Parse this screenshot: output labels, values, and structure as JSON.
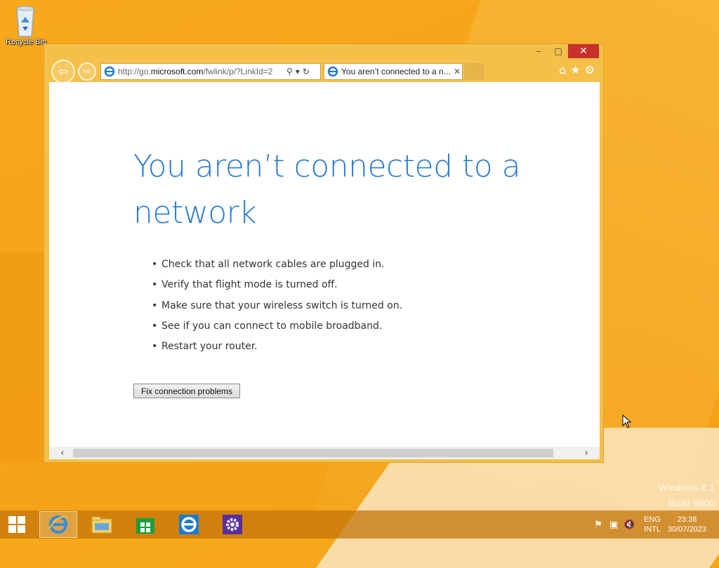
{
  "desktop": {
    "recycle_bin_label": "Recycle Bin",
    "watermark_line1": "Windows 8.1",
    "watermark_line2": "Build 9600"
  },
  "browser": {
    "address_url_prefix": "http://go.",
    "address_url_domain": "microsoft.com",
    "address_url_suffix": "/fwlink/p/?LinkId=2",
    "tab_title": "You aren’t connected to a n...",
    "window_controls": {
      "minimize": "–",
      "maximize": "□",
      "close": "✕"
    },
    "icons": [
      "back-arrow-icon",
      "forward-arrow-icon",
      "ie-favicon",
      "search-icon",
      "dropdown-icon",
      "refresh-icon",
      "home-icon",
      "favorites-star-icon",
      "tools-gear-icon"
    ]
  },
  "page": {
    "heading": "You aren’t connected to a network",
    "bullets": [
      "Check that all network cables are plugged in.",
      "Verify that flight mode is turned off.",
      "Make sure that your wireless switch is turned on.",
      "See if you can connect to mobile broadband.",
      "Restart your router."
    ],
    "fix_button": "Fix connection problems"
  },
  "taskbar": {
    "items": [
      "Internet Explorer",
      "File Explorer",
      "Store",
      "Internet Explorer",
      "Settings"
    ],
    "lang_line1": "ENG",
    "lang_line2": "INTL",
    "time": "23:38",
    "date": "30/07/2023"
  },
  "colors": {
    "accent_blue": "#2a7bd3",
    "desktop_orange": "#f5a51a",
    "close_red": "#c7302b"
  }
}
